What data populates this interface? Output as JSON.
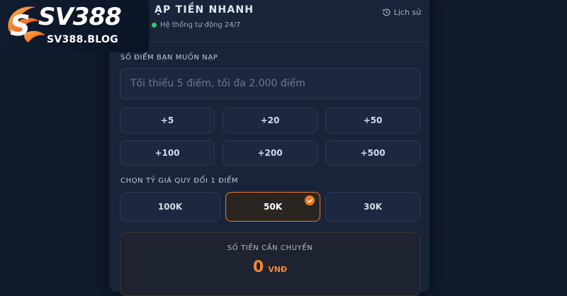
{
  "logo": {
    "text": "SV388",
    "subtext": "SV388.BLOG"
  },
  "header": {
    "title": "ẠP TIỀN NHANH",
    "status": "Hệ thống tự động 24/7",
    "history_label": "Lịch sử"
  },
  "amount": {
    "label": "SỐ ĐIỂM BẠN MUỐN NẠP",
    "placeholder": "Tối thiểu 5 điểm, tối đa 2.000 điểm",
    "value": ""
  },
  "quick_amounts": [
    "+5",
    "+20",
    "+50",
    "+100",
    "+200",
    "+500"
  ],
  "rate": {
    "label": "CHỌN TỶ GIÁ QUY ĐỔI 1 ĐIỂM",
    "options": [
      "100K",
      "50K",
      "30K"
    ],
    "selected": "50K"
  },
  "transfer": {
    "label": "SỐ TIỀN CẦN CHUYỂN",
    "value": "0",
    "unit": "VNĐ"
  },
  "colors": {
    "accent": "#f07a24",
    "status_ok": "#34c86a",
    "background": "#111a2a",
    "panel": "#19243a"
  },
  "icons": {
    "history": "history-clock-icon",
    "selected": "check-icon",
    "status": "status-dot-icon"
  }
}
